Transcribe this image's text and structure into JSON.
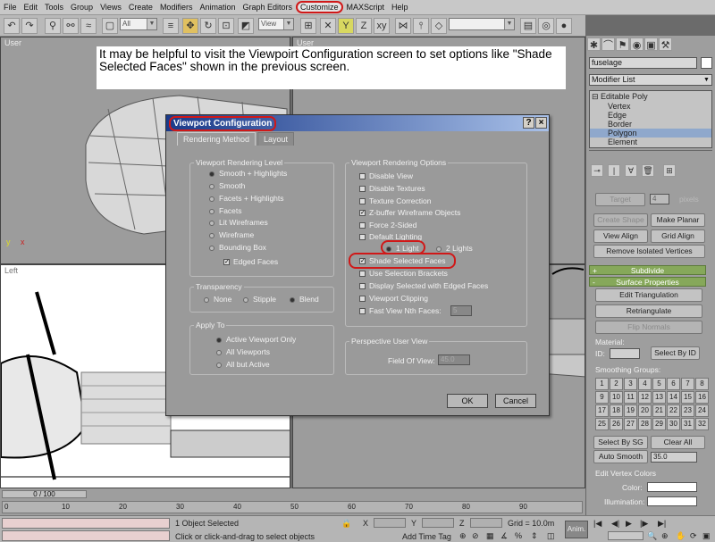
{
  "menu": [
    "File",
    "Edit",
    "Tools",
    "Group",
    "Views",
    "Create",
    "Modifiers",
    "Animation",
    "Graph Editors",
    "Customize",
    "MAXScript",
    "Help"
  ],
  "toolbar": {
    "selection_filter": "All",
    "ref_coord": "View"
  },
  "viewports": {
    "top_left": "User",
    "top_right": "User",
    "bottom_left": "Left"
  },
  "note": "It may be helpful to visit the Viewpoirt Configuration screen to set options like \"Shade Selected Faces\" shown in the previous screen.",
  "dialog": {
    "title": "Viewport Configuration",
    "help_btn": "?",
    "close_btn": "×",
    "tabs": [
      "Rendering Method",
      "Layout"
    ],
    "rendering_level": {
      "title": "Viewport Rendering Level",
      "options": [
        "Smooth + Highlights",
        "Smooth",
        "Facets + Highlights",
        "Facets",
        "Lit Wireframes",
        "Wireframe",
        "Bounding Box"
      ],
      "edged_faces": "Edged Faces"
    },
    "transparency": {
      "title": "Transparency",
      "options": [
        "None",
        "Stipple",
        "Blend"
      ]
    },
    "apply_to": {
      "title": "Apply To",
      "options": [
        "Active Viewport Only",
        "All Viewports",
        "All but Active"
      ]
    },
    "rendering_options": {
      "title": "Viewport Rendering Options",
      "items": [
        "Disable View",
        "Disable Textures",
        "Texture Correction",
        "Z-buffer Wireframe Objects",
        "Force 2-Sided",
        "Default Lighting"
      ],
      "light_1": "1 Light",
      "light_2": "2 Lights",
      "more": [
        "Shade Selected Faces",
        "Use Selection Brackets",
        "Display Selected with Edged Faces",
        "Viewport Clipping",
        "Fast View Nth Faces:"
      ],
      "nth_value": "5"
    },
    "perspective": {
      "title": "Perspective User View",
      "fov_label": "Field Of View:",
      "fov_value": "45.0"
    },
    "ok": "OK",
    "cancel": "Cancel"
  },
  "cmd": {
    "object_name": "fuselage",
    "modifier_list": "Modifier List",
    "stack": [
      "Editable Poly",
      "Vertex",
      "Edge",
      "Border",
      "Polygon",
      "Element"
    ],
    "target": "Target",
    "target_val": "4",
    "pixels": "pixels",
    "create_shape": "Create Shape",
    "make_planar": "Make Planar",
    "view_align": "View Align",
    "grid_align": "Grid Align",
    "remove_iso": "Remove Isolated Vertices",
    "subdivide": "Subdivide",
    "surface_props": "Surface Properties",
    "edit_tri": "Edit Triangulation",
    "retriangulate": "Retriangulate",
    "flip_normals": "Flip Normals",
    "material": "Material:",
    "id": "ID:",
    "select_by_id": "Select By ID",
    "smoothing": "Smoothing Groups:",
    "sg": [
      "1",
      "2",
      "3",
      "4",
      "5",
      "6",
      "7",
      "8",
      "9",
      "10",
      "11",
      "12",
      "13",
      "14",
      "15",
      "16",
      "17",
      "18",
      "19",
      "20",
      "21",
      "22",
      "23",
      "24",
      "25",
      "26",
      "27",
      "28",
      "29",
      "30",
      "31",
      "32"
    ],
    "select_by_sg": "Select By SG",
    "clear_all": "Clear All",
    "auto_smooth": "Auto Smooth",
    "auto_smooth_val": "35.0",
    "edit_vertex_colors": "Edit Vertex Colors",
    "color": "Color:",
    "illumination": "Illumination:"
  },
  "timeline": {
    "frame": "0 / 100",
    "ticks": [
      "0",
      "10",
      "20",
      "30",
      "40",
      "50",
      "60",
      "70",
      "80",
      "90"
    ]
  },
  "status": {
    "selected": "1 Object Selected",
    "prompt": "Click or click-and-drag to select objects",
    "x": "X",
    "y": "Y",
    "z": "Z",
    "grid": "Grid = 10.0m",
    "add_time_tag": "Add Time Tag",
    "anim": "Anim."
  }
}
